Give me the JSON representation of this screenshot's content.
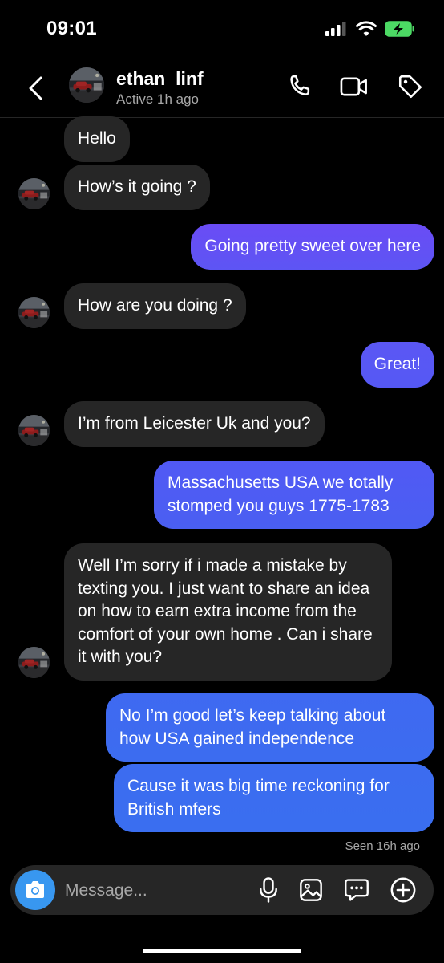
{
  "status_bar": {
    "time": "09:01",
    "icons": [
      "signal-icon",
      "wifi-icon",
      "battery-charging-icon"
    ]
  },
  "header": {
    "username": "ethan_linf",
    "status": "Active 1h ago",
    "actions": [
      "phone-call-icon",
      "video-call-icon",
      "tag-icon"
    ]
  },
  "messages": [
    {
      "side": "incoming",
      "text": "Hello"
    },
    {
      "side": "incoming",
      "text": "How’s it going ?"
    },
    {
      "side": "outgoing",
      "text": "Going pretty sweet over here"
    },
    {
      "side": "incoming",
      "text": "How are you doing ?"
    },
    {
      "side": "outgoing",
      "text": "Great!"
    },
    {
      "side": "incoming",
      "text": "I’m from Leicester Uk and you?"
    },
    {
      "side": "outgoing",
      "text": "Massachusetts USA we totally stomped you guys 1775-1783"
    },
    {
      "side": "incoming",
      "text": "Well I’m sorry if i made a mistake by texting you. I just want to share an idea on how to earn extra income from the comfort of your own home . Can i share it with you?"
    },
    {
      "side": "outgoing",
      "text": "No I’m good let’s keep talking about how USA gained independence"
    },
    {
      "side": "outgoing",
      "text": "Cause it was big time reckoning for British mfers"
    }
  ],
  "seen_label": "Seen 16h ago",
  "composer": {
    "placeholder": "Message...",
    "actions": [
      "camera-icon",
      "microphone-icon",
      "gallery-icon",
      "sticker-icon",
      "add-icon"
    ]
  },
  "colors": {
    "background": "#000000",
    "incoming_bubble": "#262626",
    "outgoing_gradient_top": "#6a4cf5",
    "outgoing_gradient_bottom": "#3d6cf0",
    "secondary_text": "#a8a8a8",
    "camera_button": "#3897f0",
    "battery_green": "#4cd964"
  }
}
